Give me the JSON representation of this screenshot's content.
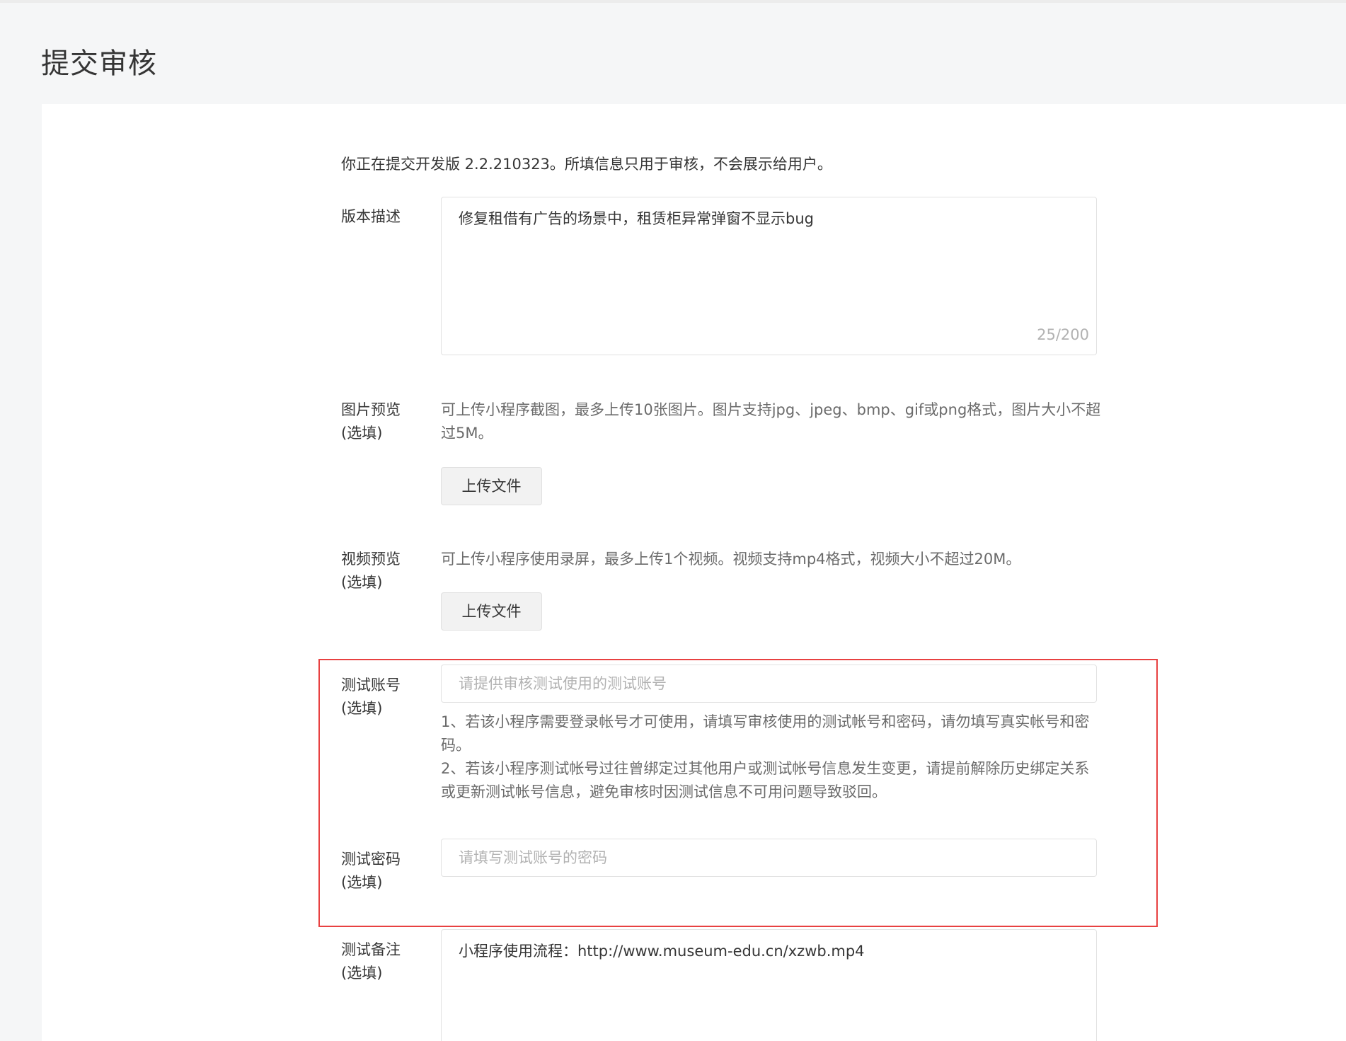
{
  "page_title": "提交审核",
  "intro": "你正在提交开发版 2.2.210323。所填信息只用于审核，不会展示给用户。",
  "version_desc": {
    "label": "版本描述",
    "value": "修复租借有广告的场景中，租赁柜异常弹窗不显示bug",
    "counter": "25/200"
  },
  "image_preview": {
    "label_line1": "图片预览",
    "label_line2": "(选填)",
    "help_line1": "可上传小程序截图，最多上传10张图片。图片支持jpg、jpeg、bmp、gif或png格式，图片大小不超",
    "help_line2": "过5M。",
    "button": "上传文件"
  },
  "video_preview": {
    "label_line1": "视频预览",
    "label_line2": "(选填)",
    "help": "可上传小程序使用录屏，最多上传1个视频。视频支持mp4格式，视频大小不超过20M。",
    "button": "上传文件"
  },
  "test_account": {
    "label_line1": "测试账号",
    "label_line2": "(选填)",
    "placeholder": "请提供审核测试使用的测试账号",
    "help_line1": "1、若该小程序需要登录帐号才可使用，请填写审核使用的测试帐号和密码，请勿填写真实帐号和密",
    "help_line2": "码。",
    "help_line3": "2、若该小程序测试帐号过往曾绑定过其他用户或测试帐号信息发生变更，请提前解除历史绑定关系",
    "help_line4": "或更新测试帐号信息，避免审核时因测试信息不可用问题导致驳回。"
  },
  "test_password": {
    "label_line1": "测试密码",
    "label_line2": "(选填)",
    "placeholder": "请填写测试账号的密码"
  },
  "test_notes": {
    "label_line1": "测试备注",
    "label_line2": "(选填)",
    "value": "小程序使用流程：http://www.museum-edu.cn/xzwb.mp4"
  },
  "colors": {
    "highlight_border": "#e84141",
    "background": "#f5f6f7",
    "card": "#ffffff"
  }
}
